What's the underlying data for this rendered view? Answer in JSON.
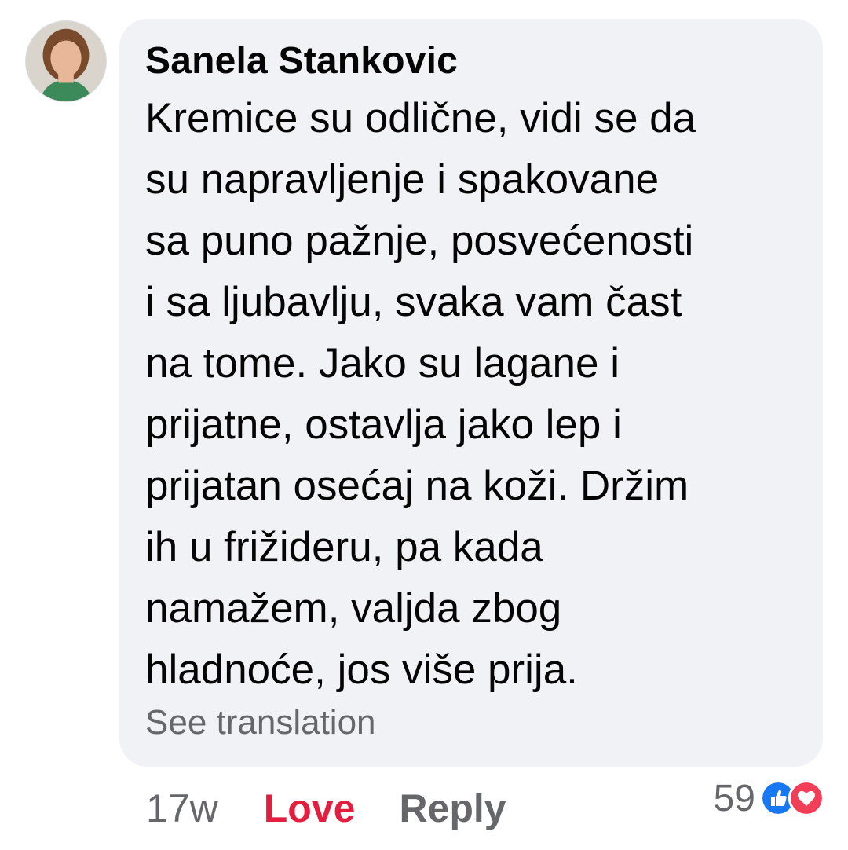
{
  "comment": {
    "author": "Sanela Stankovic",
    "text": "Kremice su odlične, vidi se da\nsu napravljenje i spakovane\nsa puno pažnje, posvećenosti\ni sa ljubavlju, svaka vam čast\nna tome. Jako su lagane i\nprijatne, ostavlja jako lep i\nprijatan osećaj na koži. Držim\nih u frižideru, pa kada\nnamažem, valjda zbog\nhladnoće, jos više prija.",
    "see_translation": "See translation",
    "avatar_icon": "user-avatar-photo"
  },
  "actions": {
    "timestamp": "17w",
    "love_label": "Love",
    "reply_label": "Reply"
  },
  "reactions": {
    "count": "59",
    "icons": [
      "like-reaction-icon",
      "love-reaction-icon"
    ]
  },
  "colors": {
    "bubble_background": "#f0f2f5",
    "text_primary": "#050505",
    "text_secondary": "#65676b",
    "love_active": "#e41e3f",
    "like_blue": "#1877f2"
  }
}
